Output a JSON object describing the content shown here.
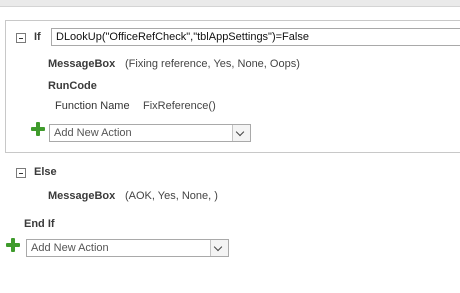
{
  "if_block": {
    "keyword": "If",
    "condition": "DLookUp(\"OfficeRefCheck\",\"tblAppSettings\")=False",
    "actions": [
      {
        "name": "MessageBox",
        "args": "(Fixing reference, Yes, None, Oops)"
      },
      {
        "name": "RunCode",
        "arg_label": "Function Name",
        "arg_value": "FixReference()"
      }
    ],
    "add_action_placeholder": "Add New Action"
  },
  "else_block": {
    "keyword": "Else",
    "actions": [
      {
        "name": "MessageBox",
        "args": "(AOK, Yes, None, )"
      }
    ]
  },
  "end_if": "End If",
  "bottom_add_action_placeholder": "Add New Action",
  "colors": {
    "plus_icon": "#3f9b2c",
    "border": "#a9a9a9"
  }
}
